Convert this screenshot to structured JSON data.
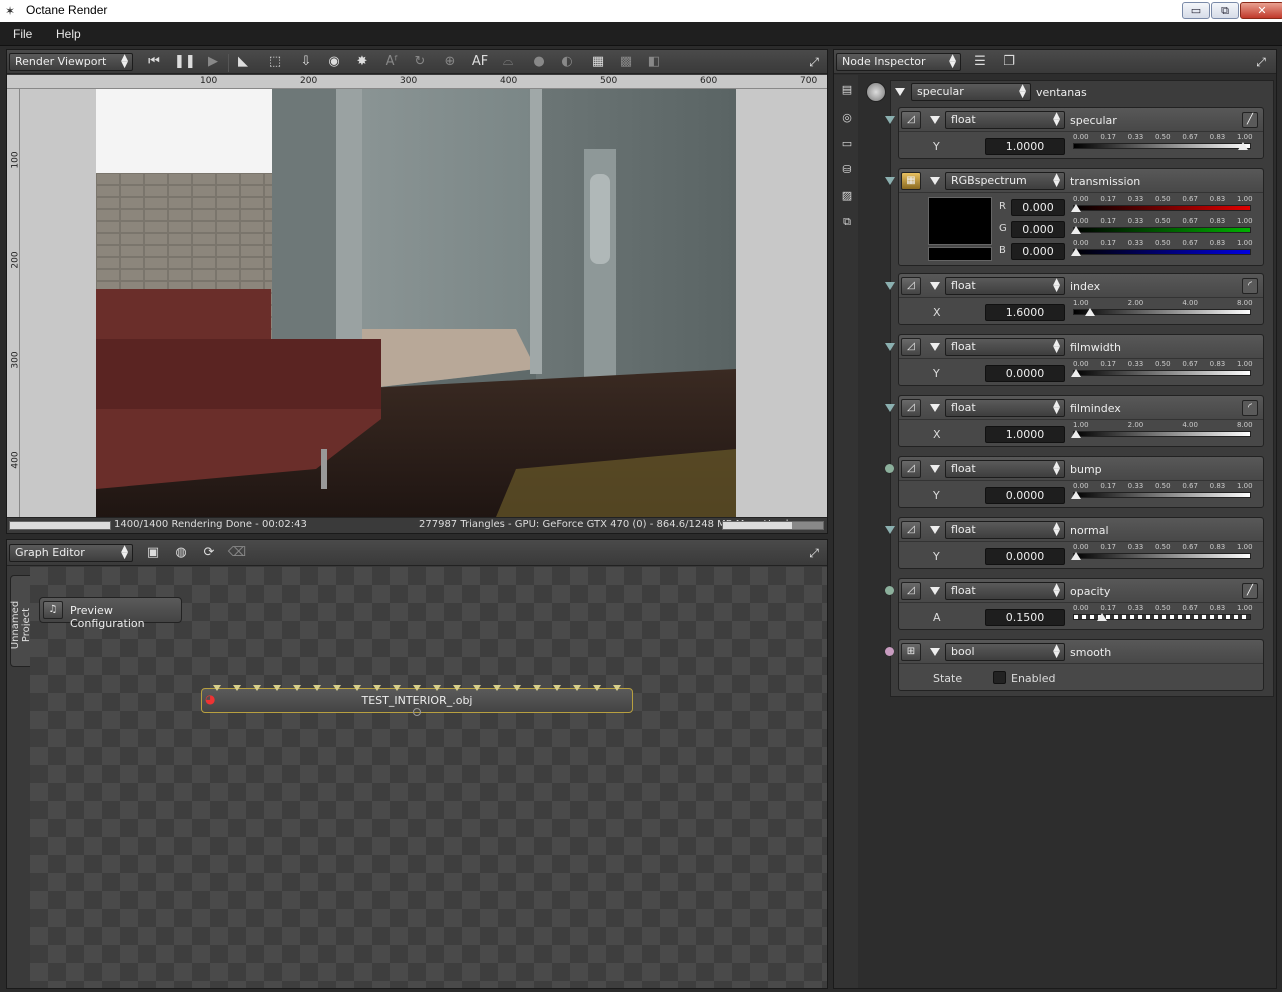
{
  "window": {
    "title": "Octane Render",
    "minimize": "▭",
    "maximize": "⧉",
    "close": "✕"
  },
  "menu": [
    "File",
    "Help"
  ],
  "viewport": {
    "mode": "Render Viewport",
    "ruler_top": [
      "100",
      "200",
      "300",
      "400",
      "500",
      "600",
      "700"
    ],
    "ruler_left": [
      "100",
      "200",
      "300",
      "400"
    ],
    "status_left": "1400/1400 Rendering Done - 00:02:43",
    "status_right": "277987 Triangles - GPU: GeForce GTX 470 (0) - 864.6/1248 MB Mem Used",
    "render_progress": 1.0,
    "mem_progress": 0.69
  },
  "graph": {
    "mode": "Graph Editor",
    "project_tab": "Unnamed Project",
    "preview_node": "Preview Configuration",
    "mesh_node": "TEST_INTERIOR_.obj"
  },
  "inspector": {
    "mode": "Node Inspector",
    "root_type": "specular",
    "root_name": "ventanas",
    "sections": [
      {
        "type": "float",
        "name": "specular",
        "axis": "Y",
        "value": "1.0000",
        "scale": [
          "0.00",
          "0.17",
          "0.33",
          "0.50",
          "0.67",
          "0.83",
          "1.00"
        ],
        "pos": 0.98
      },
      {
        "type": "float",
        "name": "index",
        "axis": "X",
        "value": "1.6000",
        "scale": [
          "1.00",
          "2.00",
          "4.00",
          "8.00"
        ],
        "pos": 0.08
      },
      {
        "type": "float",
        "name": "filmwidth",
        "axis": "Y",
        "value": "0.0000",
        "scale": [
          "0.00",
          "0.17",
          "0.33",
          "0.50",
          "0.67",
          "0.83",
          "1.00"
        ],
        "pos": 0.0
      },
      {
        "type": "float",
        "name": "filmindex",
        "axis": "X",
        "value": "1.0000",
        "scale": [
          "1.00",
          "2.00",
          "4.00",
          "8.00"
        ],
        "pos": 0.0
      },
      {
        "type": "float",
        "name": "bump",
        "axis": "Y",
        "value": "0.0000",
        "scale": [
          "0.00",
          "0.17",
          "0.33",
          "0.50",
          "0.67",
          "0.83",
          "1.00"
        ],
        "pos": 0.0
      },
      {
        "type": "float",
        "name": "normal",
        "axis": "Y",
        "value": "0.0000",
        "scale": [
          "0.00",
          "0.17",
          "0.33",
          "0.50",
          "0.67",
          "0.83",
          "1.00"
        ],
        "pos": 0.0
      },
      {
        "type": "float",
        "name": "opacity",
        "axis": "A",
        "value": "0.1500",
        "scale": [
          "0.00",
          "0.17",
          "0.33",
          "0.50",
          "0.67",
          "0.83",
          "1.00"
        ],
        "pos": 0.15
      }
    ],
    "transmission": {
      "type": "RGBspectrum",
      "name": "transmission",
      "channels": [
        {
          "axis": "R",
          "value": "0.000",
          "color": "#e00000"
        },
        {
          "axis": "G",
          "value": "0.000",
          "color": "#00b000"
        },
        {
          "axis": "B",
          "value": "0.000",
          "color": "#0000e0"
        }
      ],
      "scale": [
        "0.00",
        "0.17",
        "0.33",
        "0.50",
        "0.67",
        "0.83",
        "1.00"
      ]
    },
    "smooth": {
      "type": "bool",
      "name": "smooth",
      "label": "State",
      "checkbox_label": "Enabled",
      "checked": false
    }
  }
}
